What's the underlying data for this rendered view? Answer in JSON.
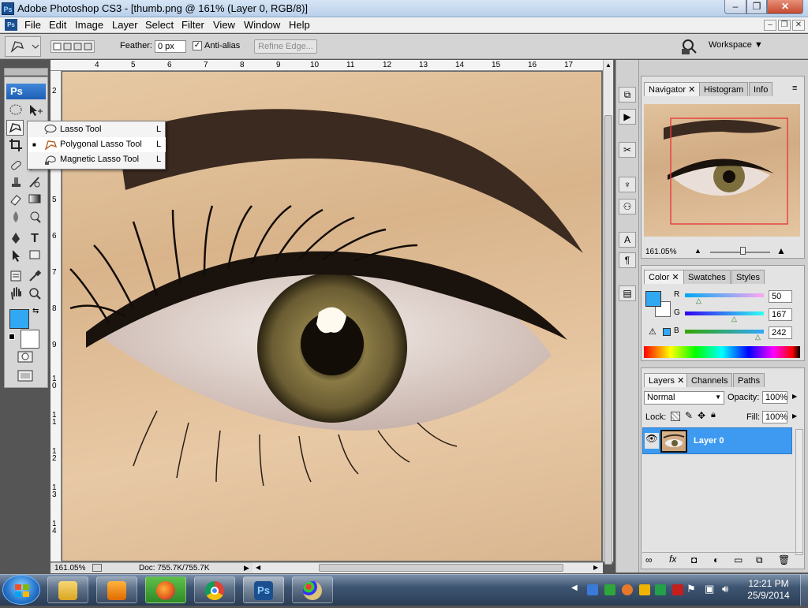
{
  "window": {
    "title": "Adobe Photoshop CS3 - [thumb.png @ 161% (Layer 0, RGB/8)]",
    "app_icon": "Ps",
    "min": "‒",
    "max": "❐",
    "close": "✕"
  },
  "menu": {
    "doc_icon": "Ps",
    "items": [
      "File",
      "Edit",
      "Image",
      "Layer",
      "Select",
      "Filter",
      "View",
      "Window",
      "Help"
    ],
    "doc_min": "‒",
    "doc_restore": "❐",
    "doc_close": "✕"
  },
  "options": {
    "feather_label": "Feather:",
    "feather_value": "0 px",
    "antialias_label": "Anti-alias",
    "antialias_checked": true,
    "refine_edge": "Refine Edge...",
    "workspace": "Workspace ▼"
  },
  "toolbox": {
    "ps_badge": "Ps",
    "foreground_color": "#32a7f2",
    "background_color": "#ffffff"
  },
  "flyout": {
    "items": [
      {
        "label": "Lasso Tool",
        "key": "L",
        "icon": "lasso-icon"
      },
      {
        "label": "Polygonal Lasso Tool",
        "key": "L",
        "icon": "polygonal-lasso-icon"
      },
      {
        "label": "Magnetic Lasso Tool",
        "key": "L",
        "icon": "magnetic-lasso-icon"
      }
    ],
    "active_marker": "■"
  },
  "rulers": {
    "top": [
      "4",
      "5",
      "6",
      "7",
      "8",
      "9",
      "10",
      "11",
      "12",
      "13",
      "14",
      "15",
      "16",
      "17"
    ],
    "left": [
      "2",
      "3",
      "4",
      "5",
      "6",
      "7",
      "8",
      "9",
      "1\n0",
      "1\n1",
      "1\n2",
      "1\n3",
      "1\n4"
    ]
  },
  "status": {
    "zoom": "161.05%",
    "doc": "Doc: 755.7K/755.7K"
  },
  "navigator": {
    "tabs": [
      "Navigator",
      "Histogram",
      "Info"
    ],
    "zoom": "161.05%"
  },
  "color_panel": {
    "tabs": [
      "Color",
      "Swatches",
      "Styles"
    ],
    "r_label": "R",
    "g_label": "G",
    "b_label": "B",
    "r": "50",
    "g": "167",
    "b": "242",
    "swatch": "#32a7f2"
  },
  "layers_panel": {
    "tabs": [
      "Layers",
      "Channels",
      "Paths"
    ],
    "blend_mode": "Normal",
    "opacity_label": "Opacity:",
    "opacity": "100%",
    "lock_label": "Lock:",
    "fill_label": "Fill:",
    "fill": "100%",
    "layer_name": "Layer 0"
  },
  "taskbar": {
    "time": "12:21 PM",
    "date": "25/9/2014",
    "apps": [
      "explorer",
      "media-player",
      "firefox",
      "chrome",
      "photoshop",
      "paint"
    ],
    "ps_label": "Ps"
  }
}
